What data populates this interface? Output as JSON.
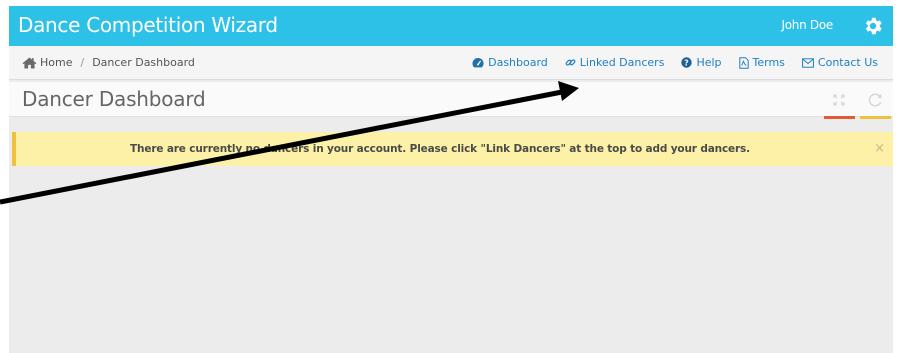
{
  "app": {
    "title": "Dance Competition Wizard"
  },
  "user": {
    "name": "John Doe",
    "settings_icon": "gear-icon"
  },
  "breadcrumb": {
    "home": "Home",
    "separator": "/",
    "current": "Dancer Dashboard"
  },
  "nav": {
    "links": [
      {
        "label": "Dashboard",
        "icon": "dashboard-icon"
      },
      {
        "label": "Linked Dancers",
        "icon": "link-icon"
      },
      {
        "label": "Help",
        "icon": "question-circle-icon"
      },
      {
        "label": "Terms",
        "icon": "document-icon"
      },
      {
        "label": "Contact Us",
        "icon": "envelope-icon"
      }
    ]
  },
  "page": {
    "title": "Dancer Dashboard",
    "tools": [
      {
        "icon": "expand-icon",
        "accent": "#e25a3a"
      },
      {
        "icon": "refresh-icon",
        "accent": "#f0c040"
      }
    ]
  },
  "alert": {
    "message": "There are currently no dancers in your account. Please click \"Link Dancers\" at the top to add your dancers.",
    "close": "×"
  },
  "colors": {
    "header": "#2ec1e8",
    "link": "#1f7ec1",
    "alert_bg": "#fcf1a6",
    "alert_border": "#f0c040"
  }
}
